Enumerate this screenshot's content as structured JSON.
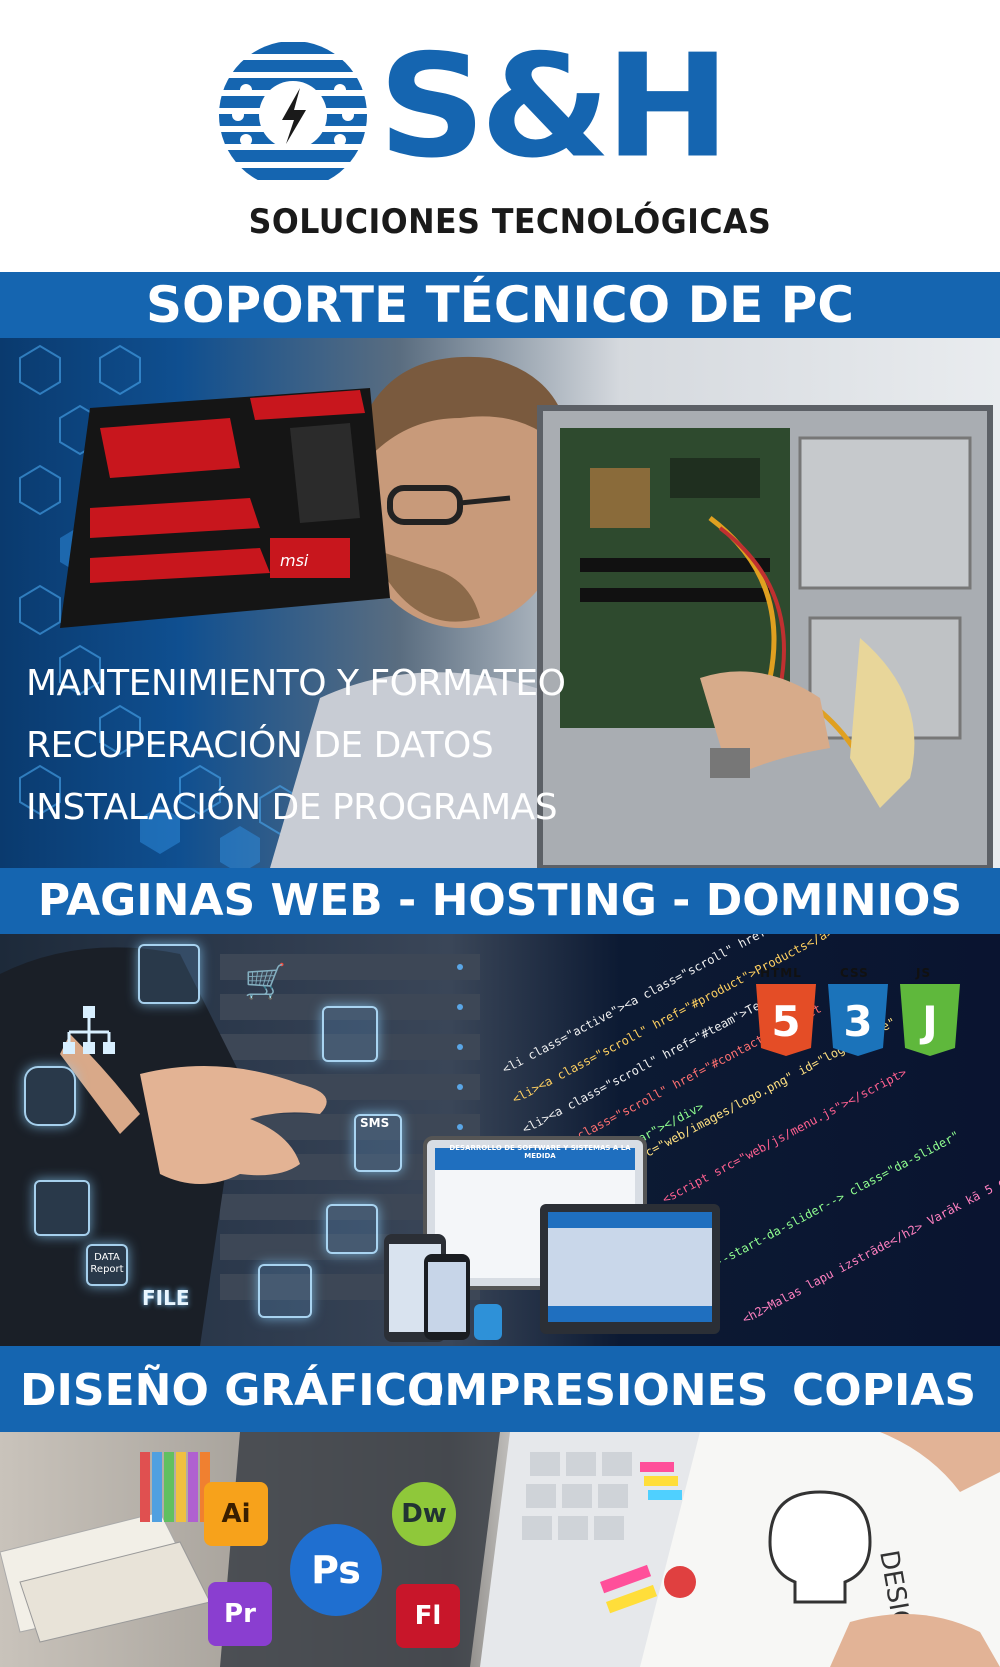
{
  "brand": {
    "name": "S&H",
    "tagline": "SOLUCIONES TECNOLÓGICAS",
    "color": "#1565b0"
  },
  "sections": {
    "pc_support": {
      "title": "SOPORTE TÉCNICO DE PC",
      "services": [
        "MANTENIMIENTO Y  FORMATEO",
        "RECUPERACIÓN DE DATOS",
        "INSTALACIÓN DE PROGRAMAS"
      ]
    },
    "web": {
      "title": "PAGINAS WEB - HOSTING - DOMINIOS",
      "badges": [
        "HTML",
        "CSS",
        "JS"
      ],
      "floating_icons": [
        "DATA Report",
        "FILE",
        "SMS"
      ],
      "device_screen_title": "DESARROLLO DE SOFTWARE Y SISTEMAS A LA MEDIDA"
    },
    "design": {
      "items": [
        "DISEÑO GRÁFICO",
        "IMPRESIONES",
        "COPIAS"
      ],
      "app_icons": [
        "Ai",
        "Ps",
        "Dw",
        "Pr",
        "Fl"
      ],
      "sketch_text": "DESIGN"
    }
  },
  "colors": {
    "banner": "#1565b0",
    "html5": "#e44d26",
    "css3": "#1b73ba",
    "js": "#5fb83c"
  }
}
